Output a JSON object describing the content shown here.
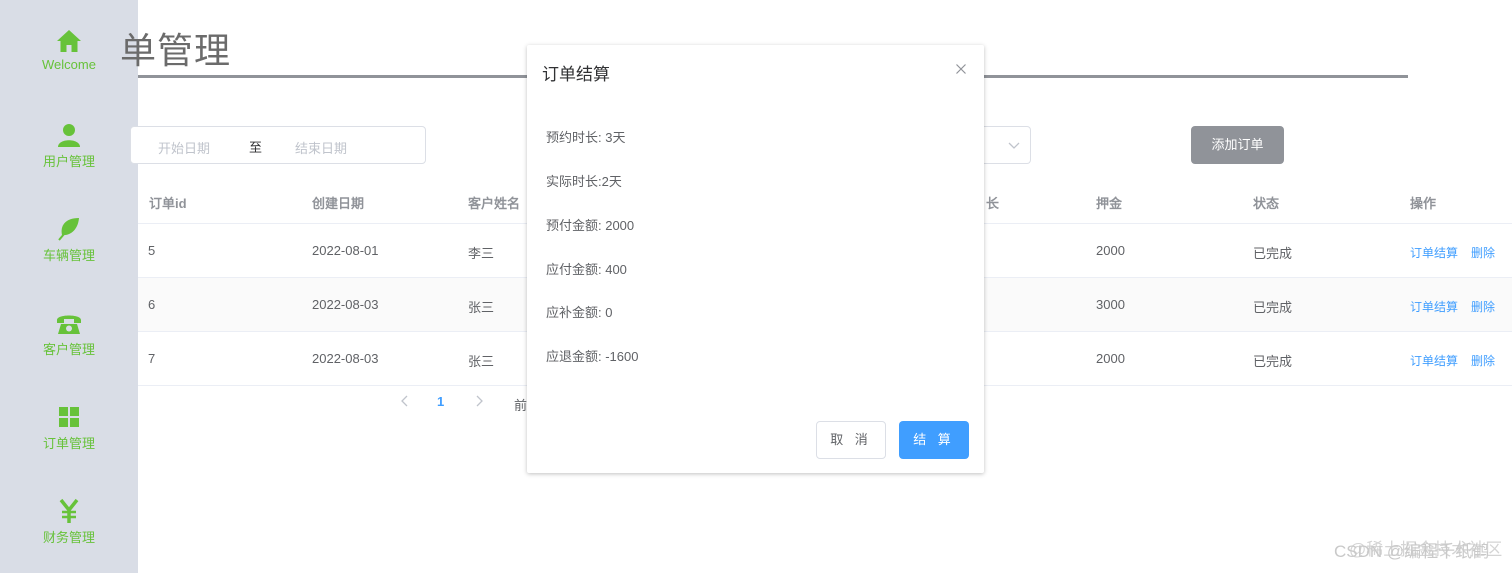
{
  "sidebar": {
    "items": [
      {
        "label": "Welcome",
        "icon": "home-icon"
      },
      {
        "label": "用户管理",
        "icon": "user-icon"
      },
      {
        "label": "车辆管理",
        "icon": "leaf-icon"
      },
      {
        "label": "客户管理",
        "icon": "phone-icon"
      },
      {
        "label": "订单管理",
        "icon": "grid-icon"
      },
      {
        "label": "财务管理",
        "icon": "yen-icon"
      }
    ],
    "accent": "#67c23a",
    "background": "#d9dde6"
  },
  "page": {
    "title": "单管理"
  },
  "filters": {
    "date_start_placeholder": "开始日期",
    "date_separator": "至",
    "date_end_placeholder": "结束日期",
    "add_button": "添加订单"
  },
  "table": {
    "headers": [
      "订单id",
      "创建日期",
      "客户姓名",
      "长",
      "押金",
      "状态",
      "操作"
    ],
    "rows": [
      {
        "id": "5",
        "date": "2022-08-01",
        "name": "李三",
        "deposit": "2000",
        "status": "已完成",
        "action1": "订单结算",
        "action2": "删除"
      },
      {
        "id": "6",
        "date": "2022-08-03",
        "name": "张三",
        "deposit": "3000",
        "status": "已完成",
        "action1": "订单结算",
        "action2": "删除"
      },
      {
        "id": "7",
        "date": "2022-08-03",
        "name": "张三",
        "deposit": "2000",
        "status": "已完成",
        "action1": "订单结算",
        "action2": "删除"
      }
    ]
  },
  "pagination": {
    "current": "1",
    "goto_label": "前"
  },
  "dialog": {
    "title": "订单结算",
    "lines": [
      "预约时长: 3天",
      "实际时长:2天",
      "预付金额: 2000",
      "应付金额: 400",
      "应补金额: 0",
      "应退金额: -1600"
    ],
    "cancel": "取 消",
    "confirm": "结 算"
  },
  "watermark": {
    "text1": "CSDN @编程千纸鹤",
    "text2": "@稀土掘金技术社区"
  },
  "colors": {
    "primary": "#409eff",
    "neutral_button": "#909399"
  }
}
